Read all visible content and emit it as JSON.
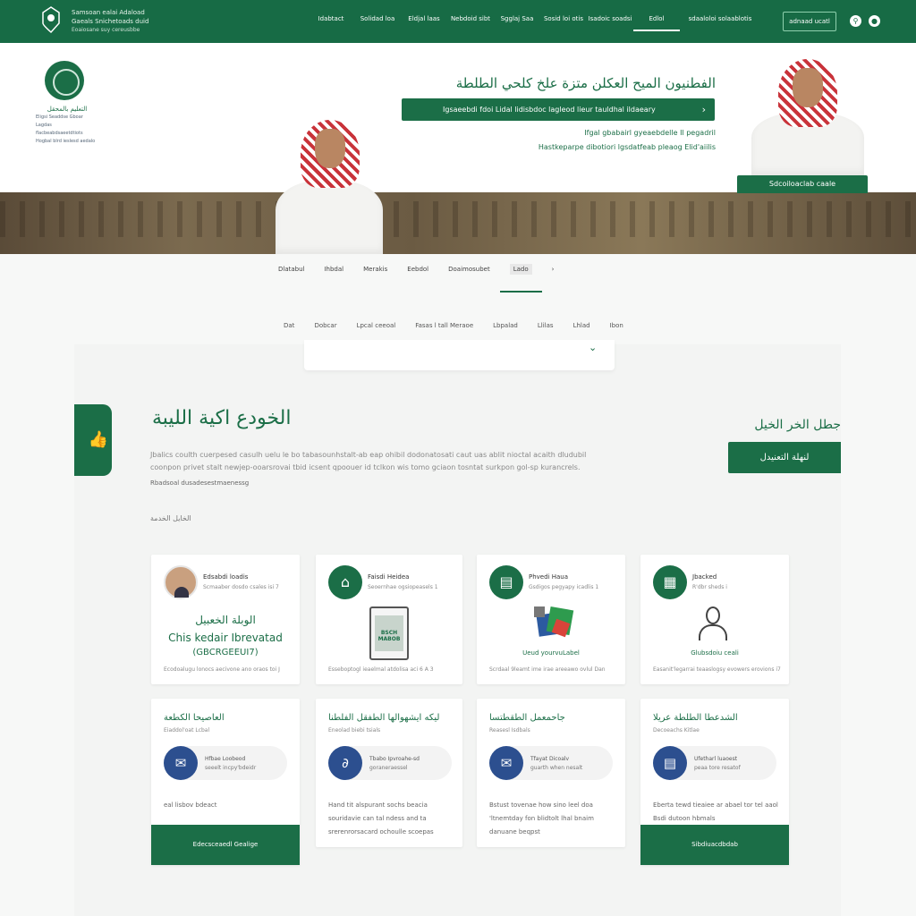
{
  "top_bar": {
    "brand_line1": "Ѕamsoan ealai Adaload",
    "brand_line2": "Gaeals Snichetoads duid",
    "brand_line3": "Eoaiosane suy cereusbbe",
    "nav": [
      "Idabtact",
      "Solidad loa",
      "Eldjal laas",
      "Nebdoid sibt",
      "Sgglaj Saa",
      "Sosid loi otis",
      "Isadoic soadsi",
      "Edlol",
      "sdaaloloi solaablotis"
    ],
    "button": "adnaad ucatl",
    "icon1": "search-icon",
    "icon2": "globe-icon"
  },
  "hero": {
    "logo_text1": "التعليم بالمحقل",
    "logo_text2": "Eligsi Seaddse Gboar",
    "logo_text3": "Lagdas flacbeabdsaeetdtiots",
    "logo_text4": "Hogbal blrd ieslesd aedalo",
    "title": "الفطنيون الميح العكلن متزة علخ كلحي الطلطة",
    "bar_text": "Igsaeebdi fdoi Lidal  lidisbdoc lagleod  lieur tauldhal ildaeary",
    "line1": "Ifgal gbabairl  gyeaebdelle Il pegadril",
    "line2": "Hastkeparpe dibotiori lgsdatfeab  pleaog  Elid'aiilis",
    "name_plate": "Sdcoiloaclab caale"
  },
  "tabs": [
    "Dlatabul",
    "Ihbdal",
    "Merakis",
    "Eebdol",
    "Doaimosubet",
    "Lado"
  ],
  "active_tab": 5,
  "subtabs": [
    "Dat",
    "Dobcar",
    "Lpcal ceeoal",
    "Fasas l tall Meraoe",
    "Lbpalad",
    "Llilas",
    "Lhlad",
    "Ibon"
  ],
  "panel": {
    "title": "الخودع اكية الليبة",
    "desc": "Jbalics coulth cuerpesed casulh uelu le bo tabasounhstalt-ab eap ohibil dodonatosati caut uas ablit nioctal acaith dludubil coonpon privet stalt newjep-ooarsrovai tbid icsent qpoouer id tclkon wis tomo gciaon tosntat surkpon gol-sp kurancrels.",
    "foot": "Rbadsoal dusadesestmaenessg",
    "section_label": "الخايل الخدمة",
    "right_title": "جطل الخر الخيل",
    "right_button": "لنهلة التعنيدل"
  },
  "cards_top": [
    {
      "title": "Edsabdi loadis",
      "sub": "Scmaaber dosdo csales isi 7",
      "big1": "الوبلة الخعبيل",
      "big2": "Chis kedair Ibrevatad",
      "big3": "(GBCRGEEUI7)",
      "foot": "Ecodoalugu lonocs aecivone ano oraos toi J"
    },
    {
      "title": "Faisdi Heidea",
      "sub": "Seoernhae ogsiopeasels 1",
      "doc_text": "BSCH MABOB",
      "foot": "Esseboptogl ieaelmal atdolisa aci 6 A 3"
    },
    {
      "title": "Phvedi Haua",
      "sub": "Gsdigos pegyapy icadlis 1",
      "caption": "Ueud yourvuLabel",
      "foot": "Scrdaal 9leamt ime irae areeawo ovlul Dan"
    },
    {
      "title": "Jbacked",
      "sub": "R'dbr sheds i",
      "caption": "Glubsdoiu ceali",
      "foot": "Easanit'legarrai teaaslogsy evowers erovions i7"
    }
  ],
  "cards_bottom": [
    {
      "title": "العاصيحا الكطعة",
      "sub": "Eiaddol'oat Lcbal",
      "p1": "Hfbae Loobeod",
      "p2": "seeelt incpy'bdeidr",
      "body": "eal lisbov bdeact",
      "button": "Edecsceaedl Gealige"
    },
    {
      "title": "ليكه ايشهوالها الطفقل الفلطنا",
      "sub": "Eneolad biebi tsials",
      "p1": "Tbabo Ipvroahe-sd",
      "p2": "goraneraessel",
      "body": "Hand tit alspurant sochs beacia souridavie can tal ndess and ta srerenrorsacard ochoulle scoepas"
    },
    {
      "title": "جاحمعمل الطقطتسا",
      "sub": "Reasesl Isdbals",
      "p1": "Tfayat Dicoalv",
      "p2": "guarth when nesalt",
      "body": "Bstust tovenae how sino leel doa 'ltnemtday fon blidtolt lhal bnaim danuane beqpst"
    },
    {
      "title": "الشدعطا الطلطة عريلا",
      "sub": "Decoeachs Kitlae",
      "p1": "Ufetharl luaoest",
      "p2": "peaa tore resatof",
      "body": "Eberta tewd tieaiee ar abael tor tel aaol Bsdi dutoon hbmals",
      "button": "Sibdiuacdbdab"
    }
  ],
  "colors": {
    "brand": "#1b6e47",
    "accent_blue": "#2c4f8f"
  }
}
